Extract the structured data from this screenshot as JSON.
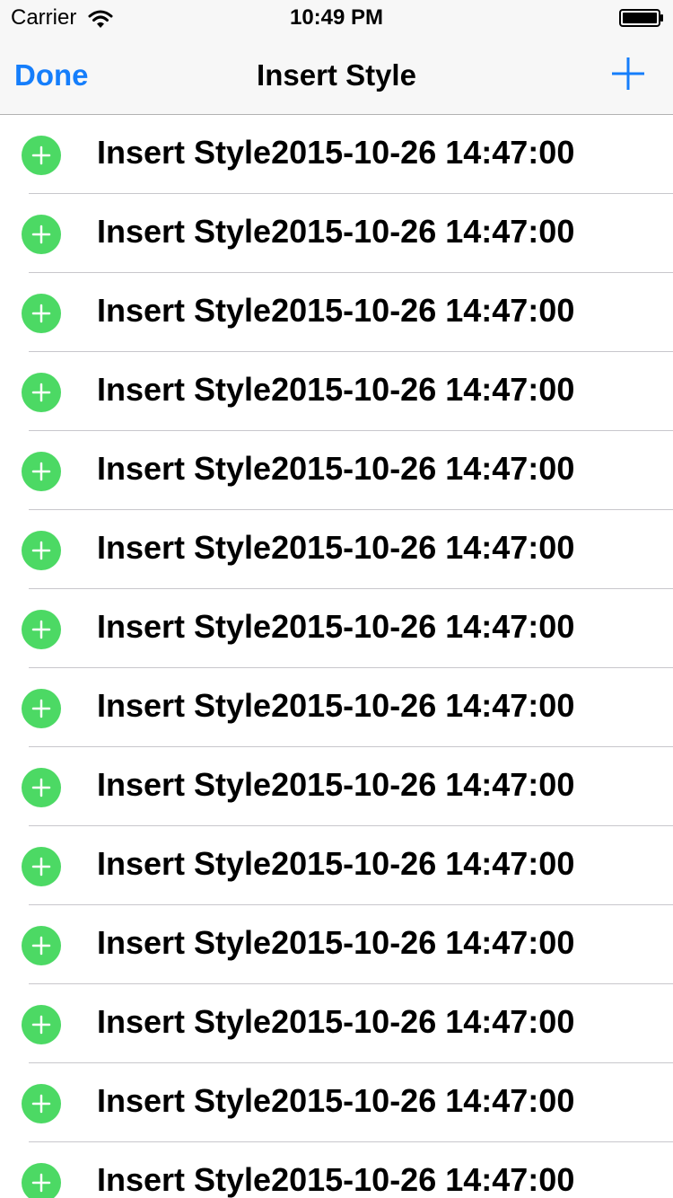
{
  "status_bar": {
    "carrier": "Carrier",
    "time": "10:49 PM",
    "wifi_icon": "wifi-icon",
    "battery_icon": "battery-icon"
  },
  "nav": {
    "done_label": "Done",
    "title": "Insert Style",
    "add_icon": "plus-icon"
  },
  "colors": {
    "accent": "#157efb",
    "insert_green": "#4cd964",
    "separator": "#c8c7cc"
  },
  "rows": [
    {
      "label": "Insert Style2015-10-26 14:47:00"
    },
    {
      "label": "Insert Style2015-10-26 14:47:00"
    },
    {
      "label": "Insert Style2015-10-26 14:47:00"
    },
    {
      "label": "Insert Style2015-10-26 14:47:00"
    },
    {
      "label": "Insert Style2015-10-26 14:47:00"
    },
    {
      "label": "Insert Style2015-10-26 14:47:00"
    },
    {
      "label": "Insert Style2015-10-26 14:47:00"
    },
    {
      "label": "Insert Style2015-10-26 14:47:00"
    },
    {
      "label": "Insert Style2015-10-26 14:47:00"
    },
    {
      "label": "Insert Style2015-10-26 14:47:00"
    },
    {
      "label": "Insert Style2015-10-26 14:47:00"
    },
    {
      "label": "Insert Style2015-10-26 14:47:00"
    },
    {
      "label": "Insert Style2015-10-26 14:47:00"
    },
    {
      "label": "Insert Style2015-10-26 14:47:00"
    }
  ]
}
